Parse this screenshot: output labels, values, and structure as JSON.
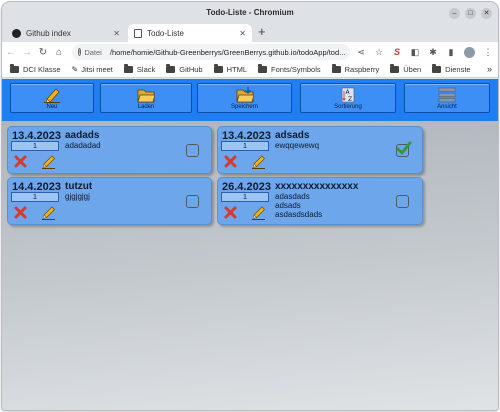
{
  "window": {
    "title": "Todo-Liste - Chromium",
    "controls": [
      "minimize",
      "maximize",
      "close"
    ]
  },
  "tabs": [
    {
      "label": "Github index",
      "icon": "github-icon",
      "close": "✕"
    },
    {
      "label": "Todo-Liste",
      "icon": "page-icon",
      "close": "✕"
    }
  ],
  "new_tab": "+",
  "omnibox": {
    "scheme": "Datei",
    "url": "/home/homie/Github-Greenberrys/GreenBerrys.github.io/todoApp/tod..."
  },
  "bookmarks": [
    {
      "label": "DCI Klasse",
      "icon": "folder-icon"
    },
    {
      "label": "Jitsi meet",
      "icon": "jitsi-icon"
    },
    {
      "label": "Slack",
      "icon": "folder-icon"
    },
    {
      "label": "GitHub",
      "icon": "folder-icon"
    },
    {
      "label": "HTML",
      "icon": "folder-icon"
    },
    {
      "label": "Fonts/Symbols",
      "icon": "folder-icon"
    },
    {
      "label": "Raspberry",
      "icon": "folder-icon"
    },
    {
      "label": "Üben",
      "icon": "folder-icon"
    },
    {
      "label": "Dienste",
      "icon": "folder-icon"
    }
  ],
  "bookmarks_more": "»",
  "app": {
    "menu": [
      {
        "label": "Neu",
        "icon": "pencil-icon"
      },
      {
        "label": "Laden",
        "icon": "open-folder-icon"
      },
      {
        "label": "Speichern",
        "icon": "save-folder-icon"
      },
      {
        "label": "Sortierung",
        "icon": "sort-az-icon"
      },
      {
        "label": "Ansicht",
        "icon": "list-view-icon"
      }
    ],
    "todos": [
      {
        "date": "13.4.2023",
        "priority": "1",
        "title": "aadads",
        "description": [
          "adadadad"
        ],
        "done": false
      },
      {
        "date": "13.4.2023",
        "priority": "1",
        "title": "adsads",
        "description": [
          "ewqqewewq"
        ],
        "done": true
      },
      {
        "date": "14.4.2023",
        "priority": "1",
        "title": "tutzut",
        "description": [
          "gjgjgjgj"
        ],
        "done": false
      },
      {
        "date": "26.4.2023",
        "priority": "1",
        "title": "xxxxxxxxxxxxxxx",
        "description": [
          "adasdads",
          "adsads",
          "asdasdsdads"
        ],
        "done": false
      }
    ],
    "colors": {
      "menubar": "#1f7ef2",
      "card": "#6ea6eb",
      "check": "#2e9b3a",
      "delete": "#d63a2a"
    }
  }
}
